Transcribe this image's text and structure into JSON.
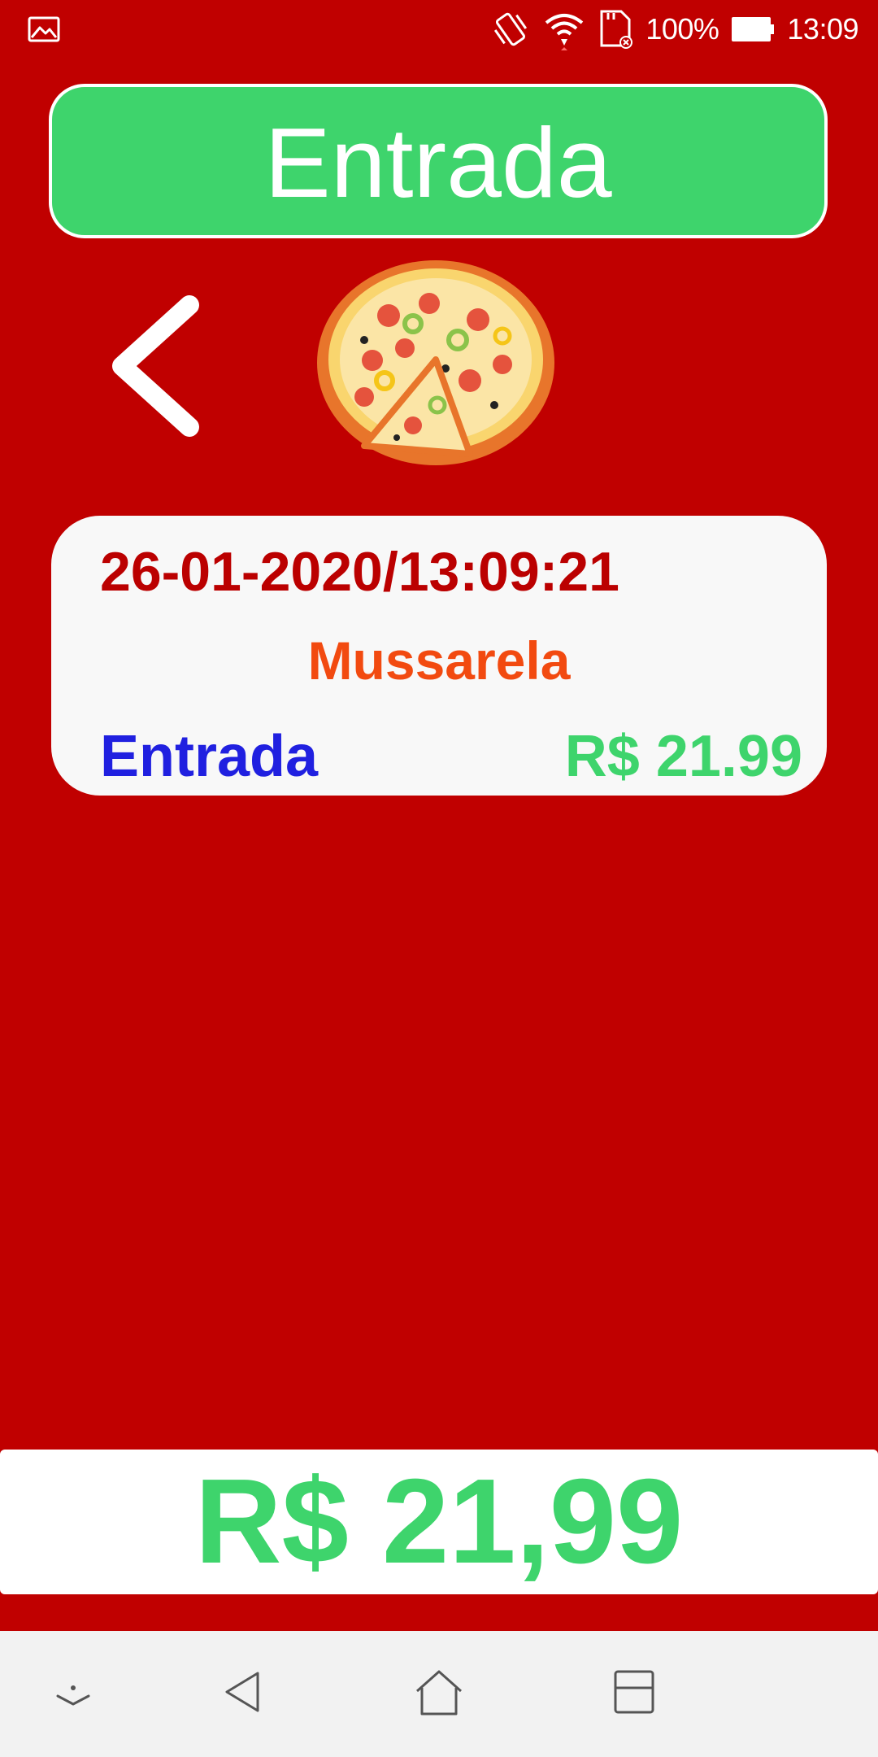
{
  "status_bar": {
    "battery_percent": "100%",
    "time": "13:09"
  },
  "header": {
    "title": "Entrada"
  },
  "transaction": {
    "datetime": "26-01-2020/13:09:21",
    "product": "Mussarela",
    "type": "Entrada",
    "price": "R$ 21.99"
  },
  "total": {
    "value": "R$ 21,99"
  },
  "icons": {
    "status_left": "image-icon",
    "vibrate": "vibrate-icon",
    "wifi": "wifi-icon",
    "sd_card": "sd-card-icon",
    "battery": "battery-icon",
    "back": "chevron-left-icon",
    "pizza": "pizza-image",
    "nav_hide": "nav-hide-icon",
    "nav_back": "nav-back-icon",
    "nav_home": "nav-home-icon",
    "nav_recents": "nav-recents-icon"
  },
  "colors": {
    "background": "#c00000",
    "accent_green": "#3ed46c",
    "datetime_red": "#bb0000",
    "product_orange": "#f24a10",
    "type_blue": "#2020e0"
  }
}
